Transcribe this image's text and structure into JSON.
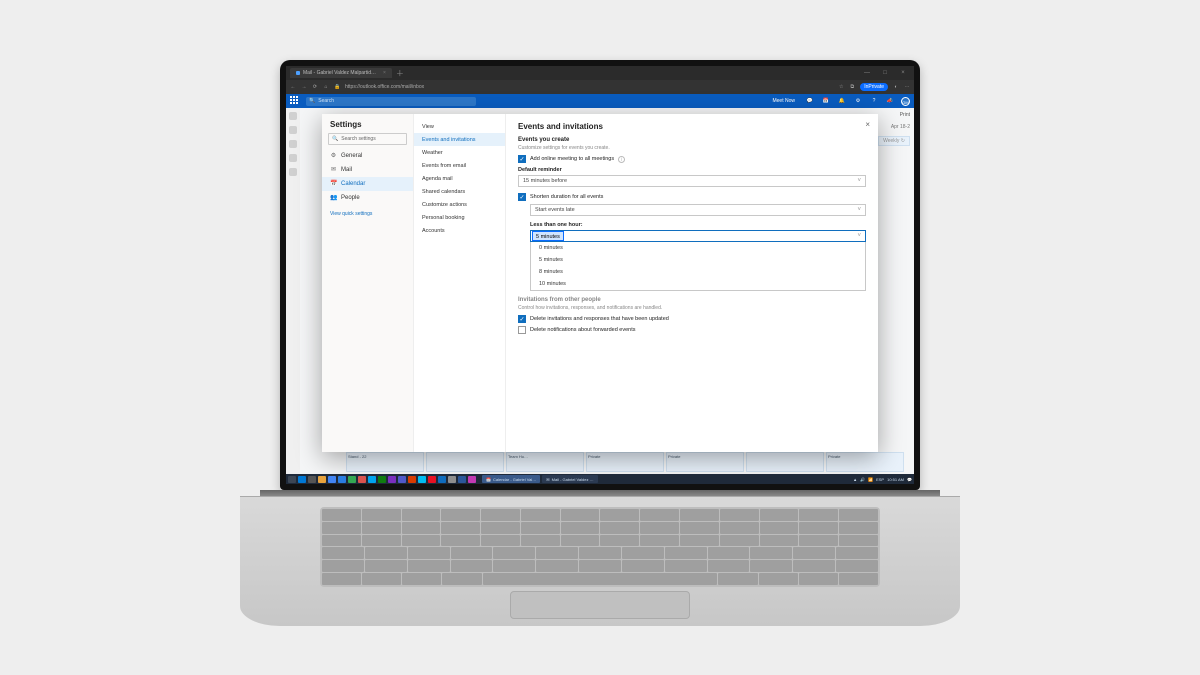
{
  "browser": {
    "tab_title": "Mail - Gabriel Valdez Malpartid…",
    "url": "https://outlook.office.com/mail/inbox",
    "inprivate_badge": "InPrivate"
  },
  "owa_header": {
    "search_placeholder": "Search",
    "meet_now": "Meet Now",
    "avatar_initials": "GM"
  },
  "toolbar_right": {
    "print": "Print",
    "weekly": "Weekly",
    "apr": "Apr 18-2"
  },
  "calendar_blocks": [
    "Stand - 22",
    "",
    "Team Hu…",
    "Private",
    "Private",
    "",
    "Private"
  ],
  "dialog": {
    "title": "Settings",
    "search_placeholder": "Search settings",
    "nav": [
      {
        "icon": "⚙",
        "label": "General"
      },
      {
        "icon": "✉",
        "label": "Mail"
      },
      {
        "icon": "📅",
        "label": "Calendar"
      },
      {
        "icon": "👥",
        "label": "People"
      }
    ],
    "nav_selected_index": 2,
    "view_quick": "View quick settings",
    "subnav": [
      "View",
      "Events and invitations",
      "Weather",
      "Events from email",
      "Agenda mail",
      "Shared calendars",
      "Customize actions",
      "Personal booking",
      "Accounts"
    ],
    "subnav_selected_index": 1,
    "panel": {
      "heading": "Events and invitations",
      "sec1": "Events you create",
      "sec1_hint": "Customize settings for events you create.",
      "chk_online": "Add online meeting to all meetings",
      "lbl_reminder": "Default reminder",
      "sel_reminder": "15 minutes before",
      "chk_shorten": "Shorten duration for all events",
      "sel_startlate": "Start events late",
      "lbl_lessthan": "Less than one hour:",
      "dd_current": "5 minutes",
      "dd_options": [
        "0 minutes",
        "5 minutes",
        "8 minutes",
        "10 minutes"
      ],
      "sec2": "Invitations from other people",
      "sec2_hint": "Control how invitations, responses, and notifications are handled.",
      "chk_del_updated": "Delete invitations and responses that have been updated",
      "chk_del_forward": "Delete notifications about forwarded events"
    }
  },
  "taskbar": {
    "apps_count": 18,
    "tasks": [
      {
        "icon": "📅",
        "label": "Calendar - Gabriel Val…",
        "active": true
      },
      {
        "icon": "✉",
        "label": "Mail - Gabriel Valdez …",
        "active": false
      }
    ],
    "tray": {
      "lang": "ESP",
      "time": "10:51 AM"
    }
  }
}
